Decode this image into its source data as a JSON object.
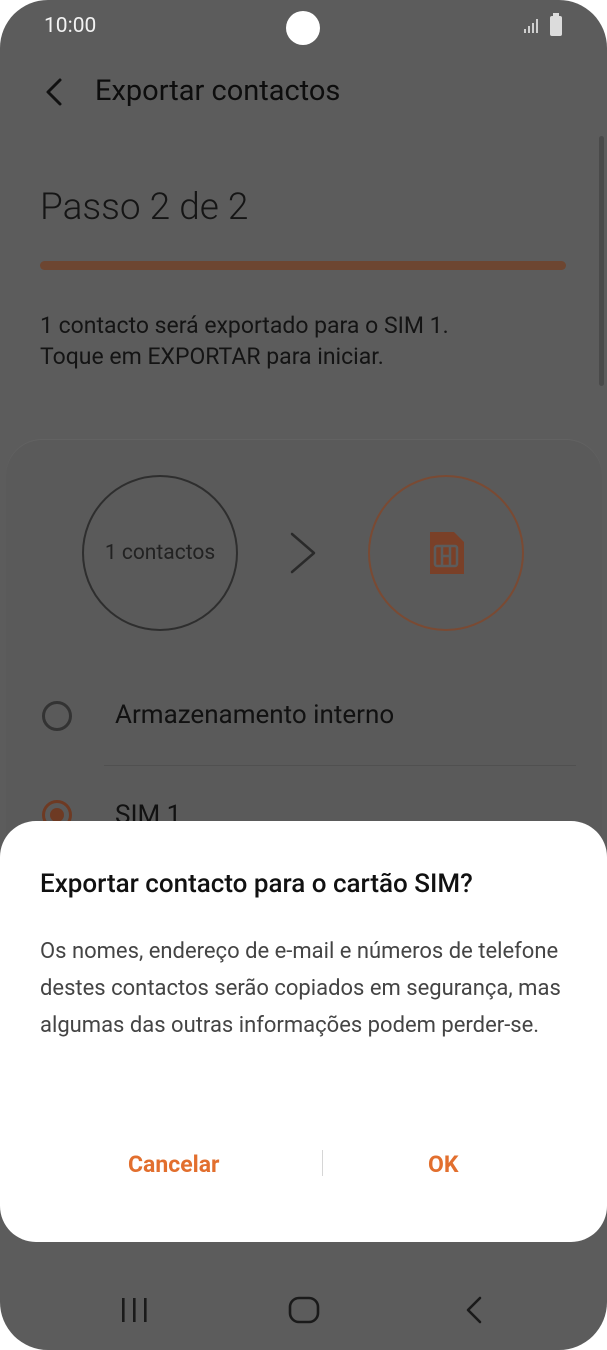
{
  "status_bar": {
    "time": "10:00"
  },
  "app_bar": {
    "title": "Exportar contactos"
  },
  "step": {
    "label": "Passo 2 de 2",
    "progress": 1.0
  },
  "description": {
    "line1": "1 contacto será exportado para o SIM 1.",
    "line2": "Toque em EXPORTAR para iniciar."
  },
  "export_visual": {
    "source_label": "1 contactos"
  },
  "options": [
    {
      "label": "Armazenamento interno",
      "selected": false
    },
    {
      "label": "SIM 1",
      "selected": true
    }
  ],
  "dialog": {
    "title": "Exportar contacto para o cartão SIM?",
    "body": "Os nomes, endereço de e-mail e números de telefone destes contactos serão copiados em segurança, mas algumas das outras informações podem perder-se.",
    "cancel_label": "Cancelar",
    "ok_label": "OK"
  },
  "colors": {
    "accent": "#e26f2e",
    "scrim": "#5c5c5c"
  }
}
